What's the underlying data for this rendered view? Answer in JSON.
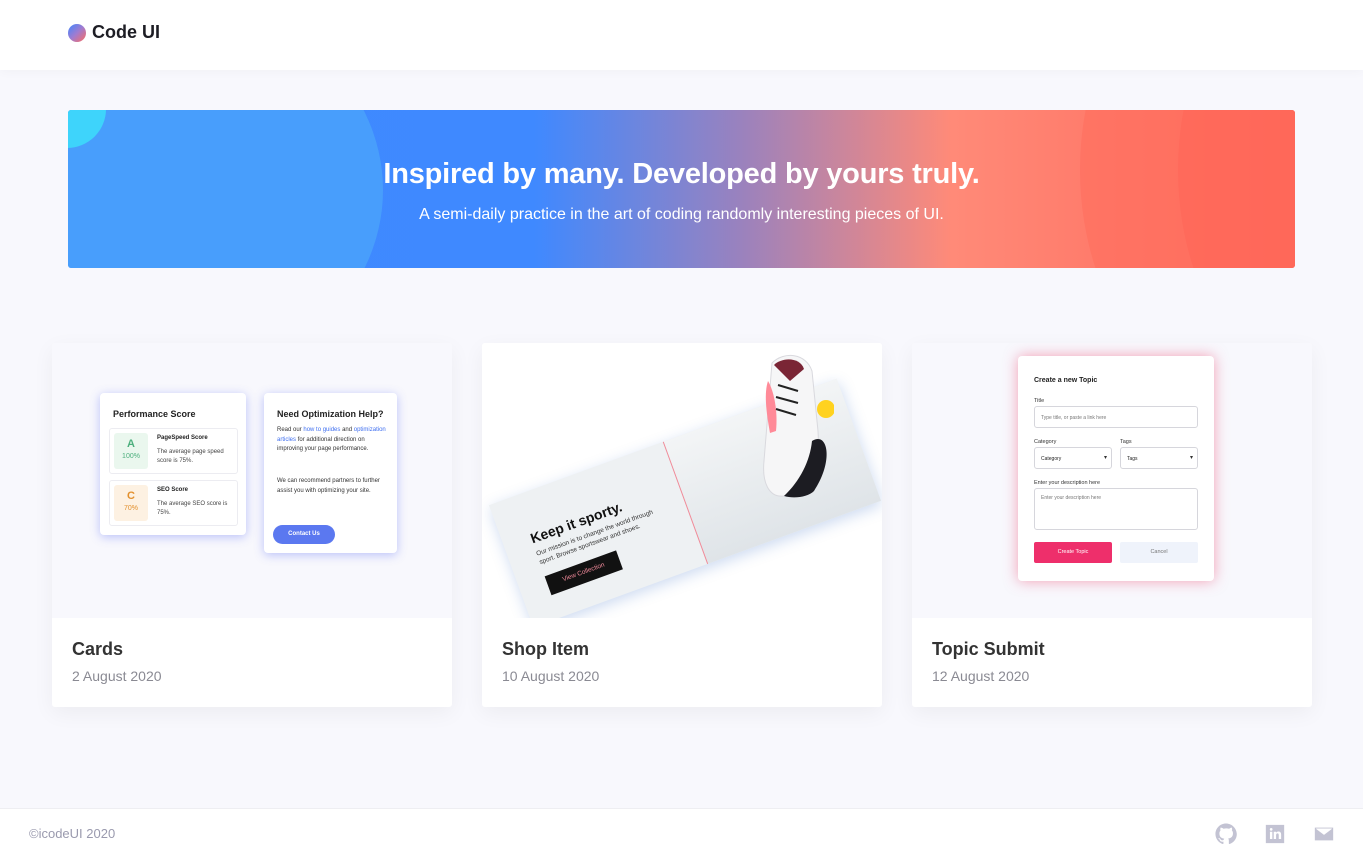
{
  "header": {
    "brand": "Code UI"
  },
  "hero": {
    "title": "Inspired by many. Developed by yours truly.",
    "subtitle": "A semi-daily practice in the art of coding randomly interesting pieces of UI."
  },
  "cards": [
    {
      "title": "Cards",
      "date": "2 August 2020",
      "preview": {
        "performance_title": "Performance Score",
        "rows": [
          {
            "grade": "A",
            "percent": "100%",
            "title": "PageSpeed Score",
            "desc": "The average page speed score is 75%."
          },
          {
            "grade": "C",
            "percent": "70%",
            "title": "SEO Score",
            "desc": "The average SEO score is 75%."
          }
        ],
        "help_title": "Need Optimization Help?",
        "help_text_1": "Read our",
        "help_link_1": "how to guides",
        "help_text_2": "and",
        "help_link_2": "optimization articles",
        "help_text_3": "for additional direction on improving your page performance.",
        "help_text_4": "We can recommend partners to further assist you with optimizing your site.",
        "contact_label": "Contact Us"
      }
    },
    {
      "title": "Shop Item",
      "date": "10 August 2020",
      "preview": {
        "headline": "Keep it sporty.",
        "text": "Our mission is to change the world through sport. Browse sportswear and shoes.",
        "button": "View Collection"
      }
    },
    {
      "title": "Topic Submit",
      "date": "12 August 2020",
      "preview": {
        "heading": "Create a new Topic",
        "title_label": "Title",
        "title_placeholder": "Type title, or paste a link here",
        "category_label": "Category",
        "category_value": "Category",
        "tags_label": "Tags",
        "tags_value": "Tags",
        "desc_label": "Enter your description here",
        "desc_placeholder": "Enter your description here",
        "create_label": "Create Topic",
        "cancel_label": "Cancel"
      }
    }
  ],
  "footer": {
    "copyright": "©icodeUI 2020",
    "icons": [
      "github-icon",
      "linkedin-icon",
      "mail-icon"
    ]
  },
  "colors": {
    "hero_blue": "#3f89ff",
    "hero_coral": "#ff6b5c",
    "accent_pink": "#ee2f6b",
    "accent_blue": "#5b78f0"
  }
}
